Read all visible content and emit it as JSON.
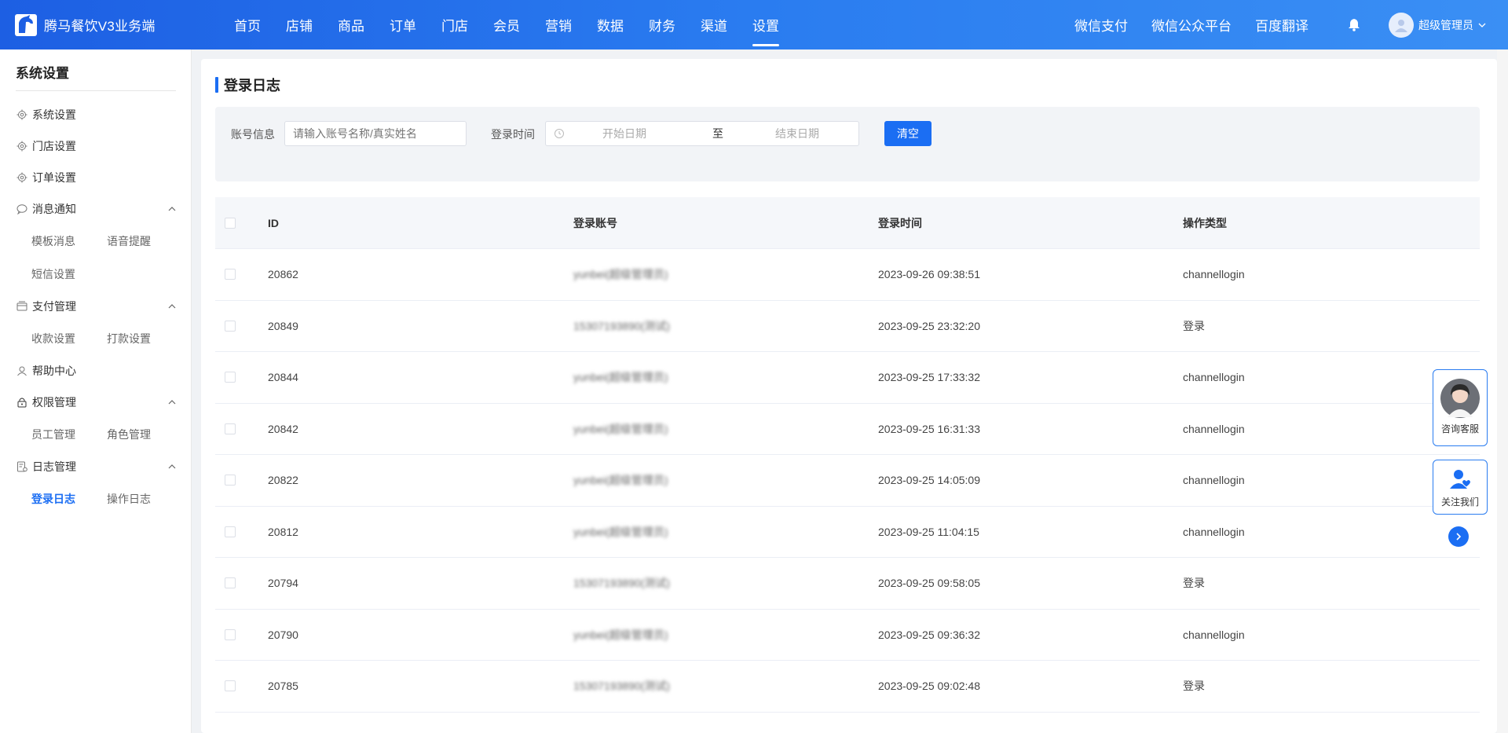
{
  "app": {
    "title": "腾马餐饮V3业务端"
  },
  "mainnav": [
    {
      "label": "首页"
    },
    {
      "label": "店铺"
    },
    {
      "label": "商品"
    },
    {
      "label": "订单"
    },
    {
      "label": "门店"
    },
    {
      "label": "会员"
    },
    {
      "label": "营销"
    },
    {
      "label": "数据"
    },
    {
      "label": "财务"
    },
    {
      "label": "渠道"
    },
    {
      "label": "设置",
      "active": true
    }
  ],
  "rightnav": {
    "links": [
      "微信支付",
      "微信公众平台",
      "百度翻译"
    ],
    "user": "超级管理员"
  },
  "sidebar": {
    "title": "系统设置",
    "items": [
      {
        "label": "系统设置",
        "icon": "gear-icon"
      },
      {
        "label": "门店设置",
        "icon": "gear-icon"
      },
      {
        "label": "订单设置",
        "icon": "gear-icon"
      },
      {
        "label": "消息通知",
        "icon": "message-icon",
        "expanded": true,
        "children": [
          "模板消息",
          "语音提醒",
          "短信设置"
        ]
      },
      {
        "label": "支付管理",
        "icon": "wallet-icon",
        "expanded": true,
        "children": [
          "收款设置",
          "打款设置"
        ]
      },
      {
        "label": "帮助中心",
        "icon": "user-icon"
      },
      {
        "label": "权限管理",
        "icon": "lock-icon",
        "expanded": true,
        "children": [
          "员工管理",
          "角色管理"
        ]
      },
      {
        "label": "日志管理",
        "icon": "log-icon",
        "expanded": true,
        "children": [
          "登录日志",
          "操作日志"
        ],
        "active_child": "登录日志"
      }
    ]
  },
  "page": {
    "title": "登录日志"
  },
  "filter": {
    "account_label": "账号信息",
    "account_placeholder": "请输入账号名称/真实姓名",
    "time_label": "登录时间",
    "start_placeholder": "开始日期",
    "separator": "至",
    "end_placeholder": "结束日期",
    "clear_button": "清空"
  },
  "table": {
    "columns": [
      "ID",
      "登录账号",
      "登录时间",
      "操作类型"
    ],
    "rows": [
      {
        "id": "20862",
        "account": "yunbei(超级管理员)",
        "time": "2023-09-26 09:38:51",
        "type": "channellogin"
      },
      {
        "id": "20849",
        "account": "15307193890(测试)",
        "time": "2023-09-25 23:32:20",
        "type": "登录"
      },
      {
        "id": "20844",
        "account": "yunbei(超级管理员)",
        "time": "2023-09-25 17:33:32",
        "type": "channellogin"
      },
      {
        "id": "20842",
        "account": "yunbei(超级管理员)",
        "time": "2023-09-25 16:31:33",
        "type": "channellogin"
      },
      {
        "id": "20822",
        "account": "yunbei(超级管理员)",
        "time": "2023-09-25 14:05:09",
        "type": "channellogin"
      },
      {
        "id": "20812",
        "account": "yunbei(超级管理员)",
        "time": "2023-09-25 11:04:15",
        "type": "channellogin"
      },
      {
        "id": "20794",
        "account": "15307193890(测试)",
        "time": "2023-09-25 09:58:05",
        "type": "登录"
      },
      {
        "id": "20790",
        "account": "yunbei(超级管理员)",
        "time": "2023-09-25 09:36:32",
        "type": "channellogin"
      },
      {
        "id": "20785",
        "account": "15307193890(测试)",
        "time": "2023-09-25 09:02:48",
        "type": "登录"
      }
    ]
  },
  "float": {
    "consult_label": "咨询客服",
    "follow_label": "关注我们"
  },
  "colors": {
    "primary": "#1b6ef3",
    "header_start": "#1d5fe3",
    "header_end": "#3a8ff4"
  }
}
